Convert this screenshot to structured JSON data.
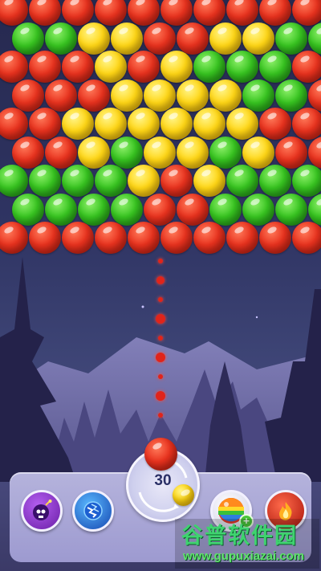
{
  "game": {
    "shots_remaining": "30",
    "current_bubble_color": "red",
    "next_bubble_color": "yellow"
  },
  "bubble_rows": [
    [
      "red",
      "red",
      "red",
      "red",
      "red",
      "red",
      "red",
      "red",
      "red",
      "red"
    ],
    [
      "green",
      "green",
      "yellow",
      "yellow",
      "red",
      "red",
      "yellow",
      "yellow",
      "green",
      "green"
    ],
    [
      "red",
      "red",
      "red",
      "yellow",
      "red",
      "yellow",
      "green",
      "green",
      "green",
      "red"
    ],
    [
      "red",
      "red",
      "red",
      "yellow",
      "yellow",
      "yellow",
      "yellow",
      "green",
      "green",
      "red"
    ],
    [
      "red",
      "red",
      "yellow",
      "yellow",
      "yellow",
      "yellow",
      "yellow",
      "yellow",
      "red",
      "red"
    ],
    [
      "red",
      "red",
      "yellow",
      "green",
      "yellow",
      "yellow",
      "green",
      "yellow",
      "red",
      "red"
    ],
    [
      "green",
      "green",
      "green",
      "green",
      "yellow",
      "red",
      "yellow",
      "green",
      "green",
      "green"
    ],
    [
      "green",
      "green",
      "green",
      "green",
      "red",
      "red",
      "green",
      "green",
      "green",
      "green"
    ],
    [
      "red",
      "red",
      "red",
      "red",
      "red",
      "red",
      "red",
      "red",
      "red",
      "red"
    ]
  ],
  "boosters": [
    {
      "name": "bomb",
      "icon": "skull-bomb-icon",
      "color": "#8a35c9"
    },
    {
      "name": "lightning",
      "icon": "lightning-icon",
      "color": "#1f6fd6"
    },
    {
      "name": "rainbow",
      "icon": "rainbow-ball-icon",
      "color": "#2a9d3a"
    },
    {
      "name": "fire",
      "icon": "fire-icon",
      "color": "#d82f1f"
    }
  ],
  "watermark": {
    "title": "谷普软件园",
    "url": "www.gupuxiazai.com"
  }
}
